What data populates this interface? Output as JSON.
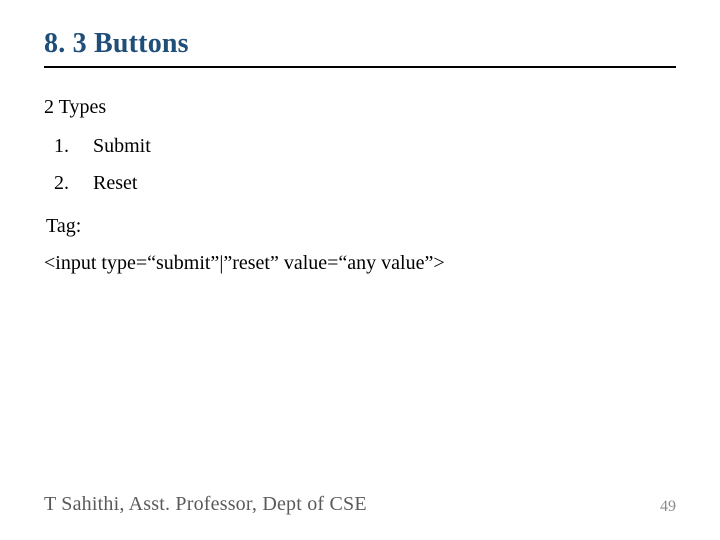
{
  "heading": "8. 3 Buttons",
  "subtitle": "2 Types",
  "list": {
    "item1": {
      "num": "1.",
      "name": "Submit"
    },
    "item2": {
      "num": "2.",
      "name": "Reset"
    }
  },
  "tag_label": "Tag:",
  "code_line": "<input type=“submit”|”reset” value=“any value”>",
  "footer": {
    "author": "T Sahithi, Asst. Professor, Dept of CSE",
    "page": "49"
  }
}
